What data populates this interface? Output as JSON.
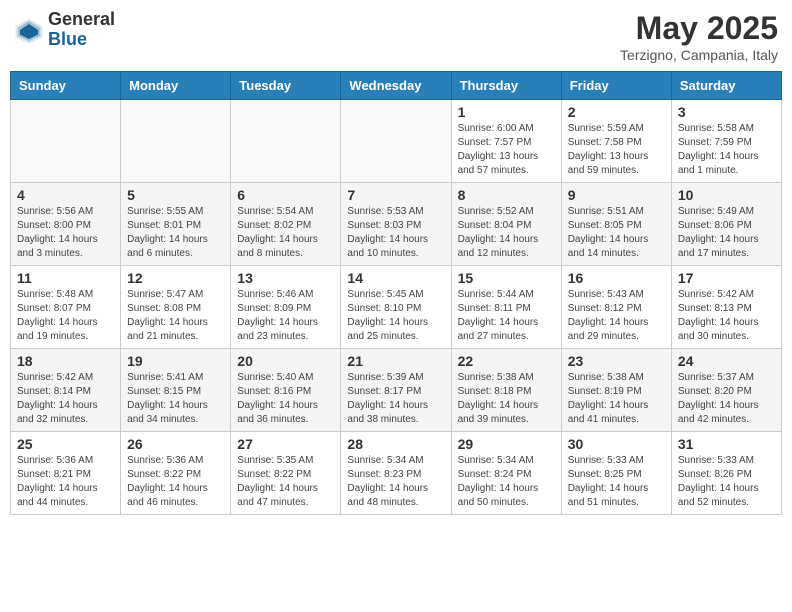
{
  "logo": {
    "general": "General",
    "blue": "Blue"
  },
  "title": {
    "month": "May 2025",
    "location": "Terzigno, Campania, Italy"
  },
  "weekdays": [
    "Sunday",
    "Monday",
    "Tuesday",
    "Wednesday",
    "Thursday",
    "Friday",
    "Saturday"
  ],
  "weeks": [
    [
      {
        "day": "",
        "info": ""
      },
      {
        "day": "",
        "info": ""
      },
      {
        "day": "",
        "info": ""
      },
      {
        "day": "",
        "info": ""
      },
      {
        "day": "1",
        "info": "Sunrise: 6:00 AM\nSunset: 7:57 PM\nDaylight: 13 hours\nand 57 minutes."
      },
      {
        "day": "2",
        "info": "Sunrise: 5:59 AM\nSunset: 7:58 PM\nDaylight: 13 hours\nand 59 minutes."
      },
      {
        "day": "3",
        "info": "Sunrise: 5:58 AM\nSunset: 7:59 PM\nDaylight: 14 hours\nand 1 minute."
      }
    ],
    [
      {
        "day": "4",
        "info": "Sunrise: 5:56 AM\nSunset: 8:00 PM\nDaylight: 14 hours\nand 3 minutes."
      },
      {
        "day": "5",
        "info": "Sunrise: 5:55 AM\nSunset: 8:01 PM\nDaylight: 14 hours\nand 6 minutes."
      },
      {
        "day": "6",
        "info": "Sunrise: 5:54 AM\nSunset: 8:02 PM\nDaylight: 14 hours\nand 8 minutes."
      },
      {
        "day": "7",
        "info": "Sunrise: 5:53 AM\nSunset: 8:03 PM\nDaylight: 14 hours\nand 10 minutes."
      },
      {
        "day": "8",
        "info": "Sunrise: 5:52 AM\nSunset: 8:04 PM\nDaylight: 14 hours\nand 12 minutes."
      },
      {
        "day": "9",
        "info": "Sunrise: 5:51 AM\nSunset: 8:05 PM\nDaylight: 14 hours\nand 14 minutes."
      },
      {
        "day": "10",
        "info": "Sunrise: 5:49 AM\nSunset: 8:06 PM\nDaylight: 14 hours\nand 17 minutes."
      }
    ],
    [
      {
        "day": "11",
        "info": "Sunrise: 5:48 AM\nSunset: 8:07 PM\nDaylight: 14 hours\nand 19 minutes."
      },
      {
        "day": "12",
        "info": "Sunrise: 5:47 AM\nSunset: 8:08 PM\nDaylight: 14 hours\nand 21 minutes."
      },
      {
        "day": "13",
        "info": "Sunrise: 5:46 AM\nSunset: 8:09 PM\nDaylight: 14 hours\nand 23 minutes."
      },
      {
        "day": "14",
        "info": "Sunrise: 5:45 AM\nSunset: 8:10 PM\nDaylight: 14 hours\nand 25 minutes."
      },
      {
        "day": "15",
        "info": "Sunrise: 5:44 AM\nSunset: 8:11 PM\nDaylight: 14 hours\nand 27 minutes."
      },
      {
        "day": "16",
        "info": "Sunrise: 5:43 AM\nSunset: 8:12 PM\nDaylight: 14 hours\nand 29 minutes."
      },
      {
        "day": "17",
        "info": "Sunrise: 5:42 AM\nSunset: 8:13 PM\nDaylight: 14 hours\nand 30 minutes."
      }
    ],
    [
      {
        "day": "18",
        "info": "Sunrise: 5:42 AM\nSunset: 8:14 PM\nDaylight: 14 hours\nand 32 minutes."
      },
      {
        "day": "19",
        "info": "Sunrise: 5:41 AM\nSunset: 8:15 PM\nDaylight: 14 hours\nand 34 minutes."
      },
      {
        "day": "20",
        "info": "Sunrise: 5:40 AM\nSunset: 8:16 PM\nDaylight: 14 hours\nand 36 minutes."
      },
      {
        "day": "21",
        "info": "Sunrise: 5:39 AM\nSunset: 8:17 PM\nDaylight: 14 hours\nand 38 minutes."
      },
      {
        "day": "22",
        "info": "Sunrise: 5:38 AM\nSunset: 8:18 PM\nDaylight: 14 hours\nand 39 minutes."
      },
      {
        "day": "23",
        "info": "Sunrise: 5:38 AM\nSunset: 8:19 PM\nDaylight: 14 hours\nand 41 minutes."
      },
      {
        "day": "24",
        "info": "Sunrise: 5:37 AM\nSunset: 8:20 PM\nDaylight: 14 hours\nand 42 minutes."
      }
    ],
    [
      {
        "day": "25",
        "info": "Sunrise: 5:36 AM\nSunset: 8:21 PM\nDaylight: 14 hours\nand 44 minutes."
      },
      {
        "day": "26",
        "info": "Sunrise: 5:36 AM\nSunset: 8:22 PM\nDaylight: 14 hours\nand 46 minutes."
      },
      {
        "day": "27",
        "info": "Sunrise: 5:35 AM\nSunset: 8:22 PM\nDaylight: 14 hours\nand 47 minutes."
      },
      {
        "day": "28",
        "info": "Sunrise: 5:34 AM\nSunset: 8:23 PM\nDaylight: 14 hours\nand 48 minutes."
      },
      {
        "day": "29",
        "info": "Sunrise: 5:34 AM\nSunset: 8:24 PM\nDaylight: 14 hours\nand 50 minutes."
      },
      {
        "day": "30",
        "info": "Sunrise: 5:33 AM\nSunset: 8:25 PM\nDaylight: 14 hours\nand 51 minutes."
      },
      {
        "day": "31",
        "info": "Sunrise: 5:33 AM\nSunset: 8:26 PM\nDaylight: 14 hours\nand 52 minutes."
      }
    ]
  ]
}
